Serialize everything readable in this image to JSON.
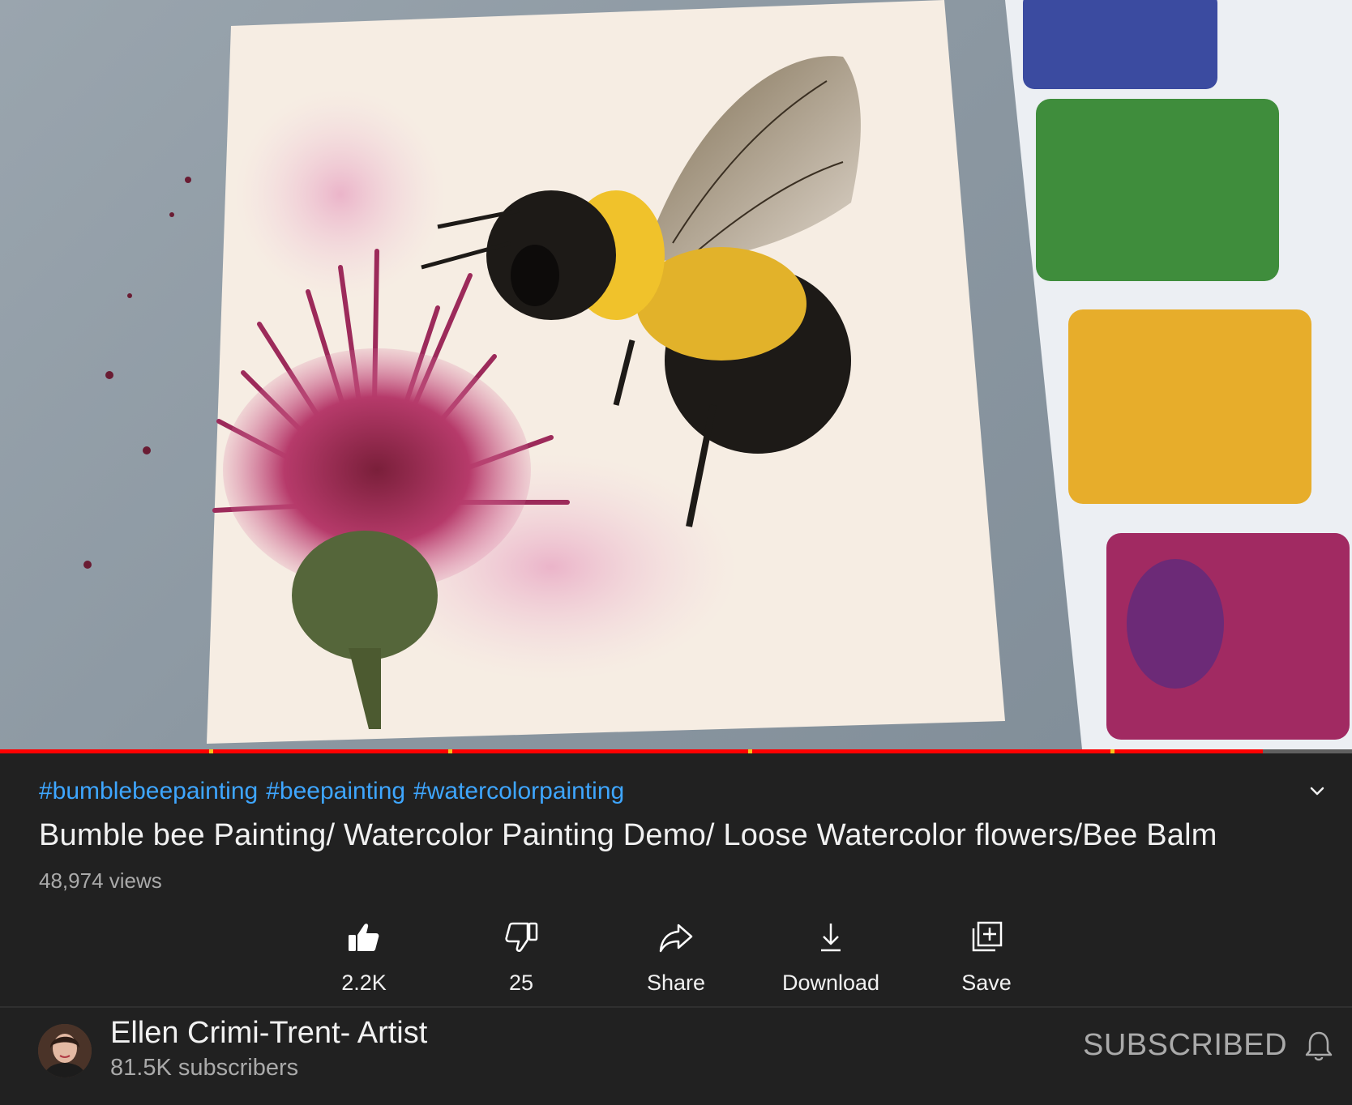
{
  "video": {
    "thumbnail_subject": "bee-and-thistle-watercolor"
  },
  "progress": {
    "played_fraction": 0.934
  },
  "info": {
    "hashtags": [
      "#bumblebeepainting",
      "#beepainting",
      "#watercolorpainting"
    ],
    "title": "Bumble bee Painting/ Watercolor Painting Demo/ Loose Watercolor flowers/Bee Balm",
    "views": "48,974 views"
  },
  "actions": {
    "like": {
      "label": "2.2K",
      "icon": "thumbs-up-icon"
    },
    "dislike": {
      "label": "25",
      "icon": "thumbs-down-icon"
    },
    "share": {
      "label": "Share",
      "icon": "share-arrow-icon"
    },
    "download": {
      "label": "Download",
      "icon": "download-icon"
    },
    "save": {
      "label": "Save",
      "icon": "add-to-playlist-icon"
    }
  },
  "channel": {
    "name": "Ellen Crimi-Trent- Artist",
    "subscribers": "81.5K subscribers",
    "subscribe_label": "SUBSCRIBED"
  },
  "colors": {
    "background": "#212121",
    "link": "#3ea6ff",
    "progress": "#ff0000",
    "secondary_text": "#aaaaaa"
  }
}
